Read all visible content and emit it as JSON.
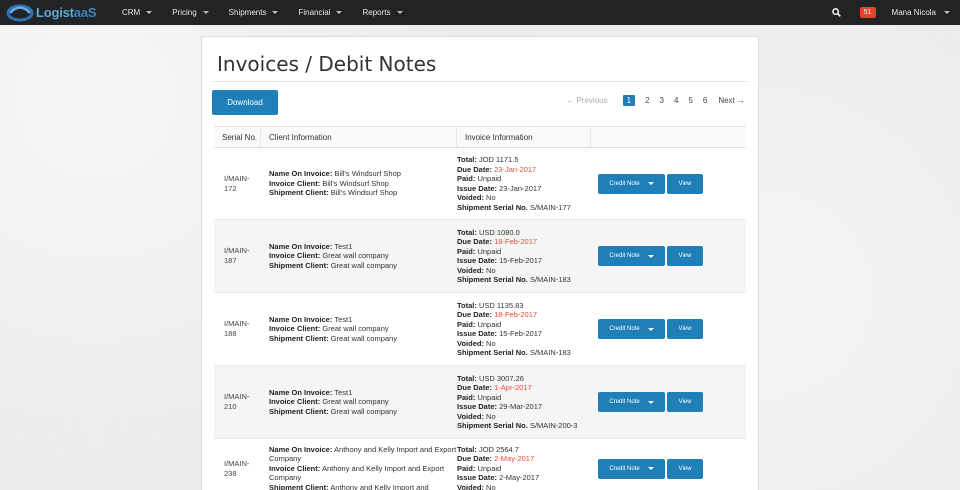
{
  "navbar": {
    "logo_part1": "Logist",
    "logo_part2": "aaS",
    "items": [
      {
        "label": "CRM"
      },
      {
        "label": "Pricing"
      },
      {
        "label": "Shipments"
      },
      {
        "label": "Financial"
      },
      {
        "label": "Reports"
      }
    ],
    "notification_count": "51",
    "user_name": "Mana Nicola"
  },
  "page": {
    "title": "Invoices / Debit Notes",
    "download_label": "Download"
  },
  "pagination": {
    "prev_label": "← Previous",
    "pages": [
      "1",
      "2",
      "3",
      "4",
      "5",
      "6"
    ],
    "active_page": "1",
    "next_label": "Next →"
  },
  "table": {
    "headers": [
      "Serial No.",
      "Client Information",
      "Invoice Information",
      ""
    ],
    "labels": {
      "name_on_invoice": "Name On Invoice:",
      "invoice_client": "Invoice Client:",
      "shipment_client": "Shipment Client:",
      "total": "Total:",
      "due_date": "Due Date:",
      "paid": "Paid:",
      "issue_date": "Issue Date:",
      "voided": "Voided:",
      "shipment_serial": "Shipment Serial No.",
      "credit_note": "Credit Note",
      "view": "View"
    },
    "rows": [
      {
        "serial_a": "I/MAIN-",
        "serial_b": "172",
        "name_on_invoice": "Bill's Windsurf Shop",
        "invoice_client": "Bill's Windsurf Shop",
        "shipment_client": "Bill's Windsurf Shop",
        "total": "JOD 1171.5",
        "due_date": "23-Jan-2017",
        "paid": "Unpaid",
        "issue_date": "23-Jan-2017",
        "voided": "No",
        "shipment_serial": "S/MAIN-177"
      },
      {
        "serial_a": "I/MAIN-",
        "serial_b": "187",
        "name_on_invoice": "Test1",
        "invoice_client": "Great wall company",
        "shipment_client": "Great wall company",
        "total": "USD 1080.0",
        "due_date": "18-Feb-2017",
        "paid": "Unpaid",
        "issue_date": "15-Feb-2017",
        "voided": "No",
        "shipment_serial": "S/MAIN-183"
      },
      {
        "serial_a": "I/MAIN-",
        "serial_b": "188",
        "name_on_invoice": "Test1",
        "invoice_client": "Great wall company",
        "shipment_client": "Great wall company",
        "total": "USD 1135.83",
        "due_date": "18-Feb-2017",
        "paid": "Unpaid",
        "issue_date": "15-Feb-2017",
        "voided": "No",
        "shipment_serial": "S/MAIN-183"
      },
      {
        "serial_a": "I/MAIN-",
        "serial_b": "210",
        "name_on_invoice": "Test1",
        "invoice_client": "Great wall company",
        "shipment_client": "Great wall company",
        "total": "USD 3007.26",
        "due_date": "1-Apr-2017",
        "paid": "Unpaid",
        "issue_date": "29-Mar-2017",
        "voided": "No",
        "shipment_serial": "S/MAIN-200-3"
      },
      {
        "serial_a": "I/MAIN-",
        "serial_b": "238",
        "name_on_invoice": "Anthony and Kelly Import and Export Company",
        "invoice_client": "Anthony and Kelly Import and Export Company",
        "shipment_client": "Anthony and Kelly Import and",
        "total": "JOD 2564.7",
        "due_date": "2-May-2017",
        "paid": "Unpaid",
        "issue_date": "2-May-2017",
        "voided": "No",
        "shipment_serial": ""
      }
    ]
  }
}
